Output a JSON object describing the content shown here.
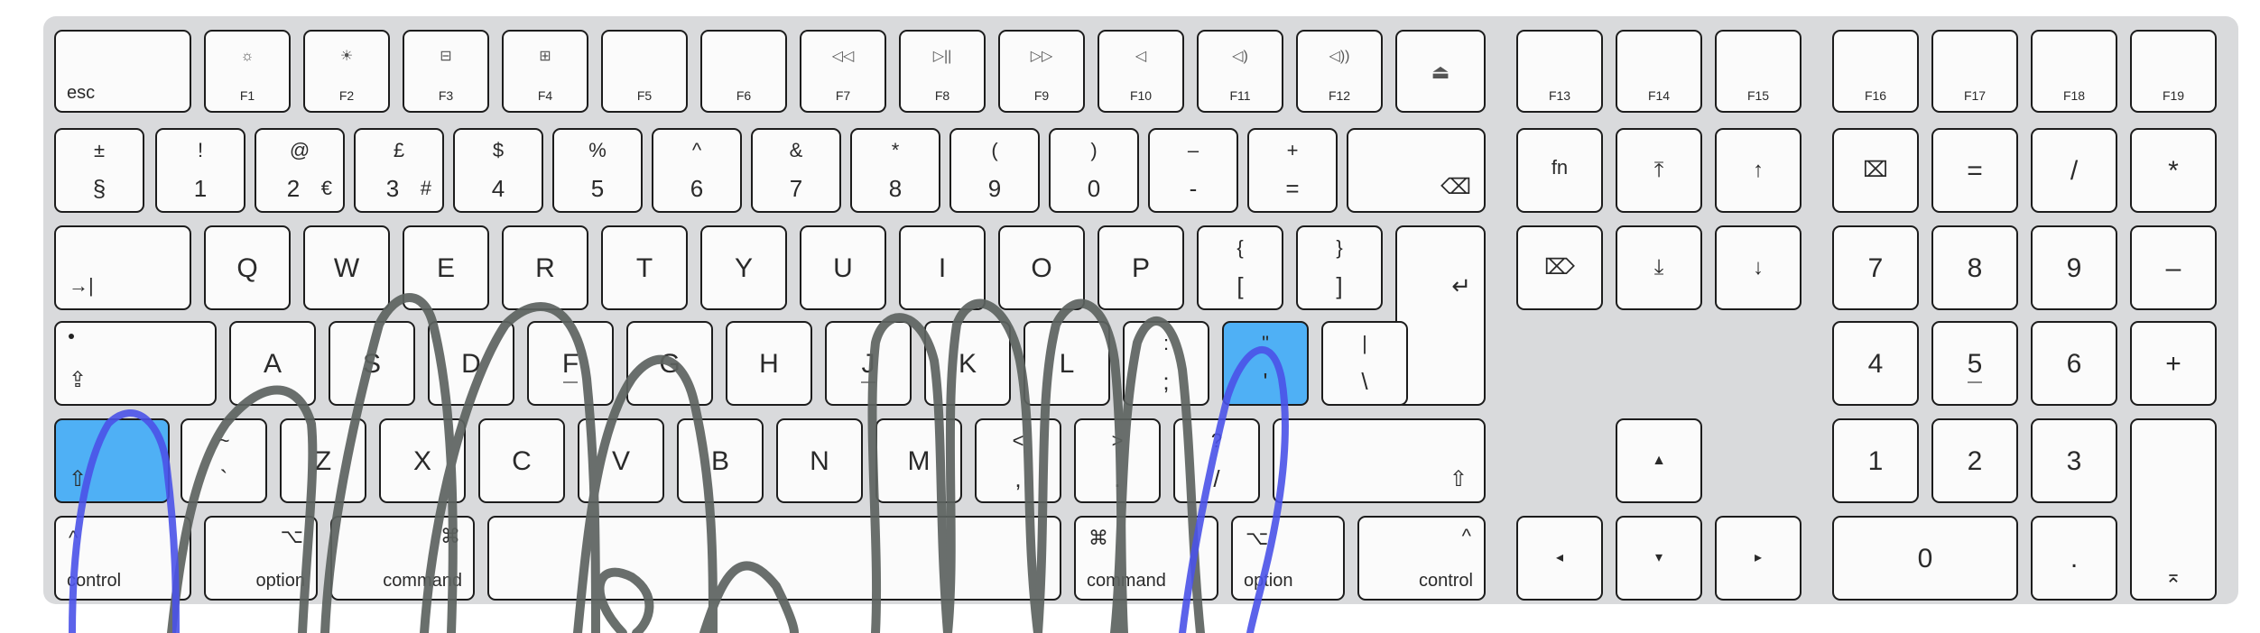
{
  "keyboard": {
    "function_row": [
      {
        "id": "esc",
        "bottom": "esc"
      },
      {
        "id": "f1",
        "icon": "☼",
        "bottom": "F1"
      },
      {
        "id": "f2",
        "icon": "☀",
        "bottom": "F2"
      },
      {
        "id": "f3",
        "icon": "⊟",
        "bottom": "F3"
      },
      {
        "id": "f4",
        "icon": "⊞",
        "bottom": "F4"
      },
      {
        "id": "f5",
        "bottom": "F5"
      },
      {
        "id": "f6",
        "bottom": "F6"
      },
      {
        "id": "f7",
        "icon": "◁◁",
        "bottom": "F7"
      },
      {
        "id": "f8",
        "icon": "▷||",
        "bottom": "F8"
      },
      {
        "id": "f9",
        "icon": "▷▷",
        "bottom": "F9"
      },
      {
        "id": "f10",
        "icon": "◁",
        "bottom": "F10"
      },
      {
        "id": "f11",
        "icon": "◁)",
        "bottom": "F11"
      },
      {
        "id": "f12",
        "icon": "◁))",
        "bottom": "F12"
      },
      {
        "id": "eject",
        "icon": "⏏"
      },
      {
        "id": "f13",
        "bottom": "F13"
      },
      {
        "id": "f14",
        "bottom": "F14"
      },
      {
        "id": "f15",
        "bottom": "F15"
      },
      {
        "id": "f16",
        "bottom": "F16"
      },
      {
        "id": "f17",
        "bottom": "F17"
      },
      {
        "id": "f18",
        "bottom": "F18"
      },
      {
        "id": "f19",
        "bottom": "F19"
      }
    ],
    "number_row": [
      {
        "id": "section",
        "top": "±",
        "bottom": "§"
      },
      {
        "id": "1",
        "top": "!",
        "bottom": "1"
      },
      {
        "id": "2",
        "top": "@",
        "bottom": "2",
        "extra": "€"
      },
      {
        "id": "3",
        "top": "£",
        "bottom": "3",
        "extra": "#"
      },
      {
        "id": "4",
        "top": "$",
        "bottom": "4"
      },
      {
        "id": "5",
        "top": "%",
        "bottom": "5"
      },
      {
        "id": "6",
        "top": "^",
        "bottom": "6"
      },
      {
        "id": "7",
        "top": "&",
        "bottom": "7"
      },
      {
        "id": "8",
        "top": "*",
        "bottom": "8"
      },
      {
        "id": "9",
        "top": "(",
        "bottom": "9"
      },
      {
        "id": "0",
        "top": ")",
        "bottom": "0"
      },
      {
        "id": "minus",
        "top": "–",
        "bottom": "-"
      },
      {
        "id": "equals",
        "top": "+",
        "bottom": "="
      },
      {
        "id": "delete",
        "icon": "⌫"
      },
      {
        "id": "fn",
        "center": "fn"
      },
      {
        "id": "home",
        "icon": "⤒"
      },
      {
        "id": "pageup",
        "icon": "↑"
      },
      {
        "id": "clear",
        "icon": "⌧"
      },
      {
        "id": "kp-equals",
        "center": "="
      },
      {
        "id": "kp-slash",
        "center": "/"
      },
      {
        "id": "kp-star",
        "center": "*"
      }
    ],
    "qwerty_row": [
      {
        "id": "tab",
        "icon": "→|"
      },
      {
        "id": "q",
        "center": "Q"
      },
      {
        "id": "w",
        "center": "W"
      },
      {
        "id": "e",
        "center": "E"
      },
      {
        "id": "r",
        "center": "R"
      },
      {
        "id": "t",
        "center": "T"
      },
      {
        "id": "y",
        "center": "Y"
      },
      {
        "id": "u",
        "center": "U"
      },
      {
        "id": "i",
        "center": "I"
      },
      {
        "id": "o",
        "center": "O"
      },
      {
        "id": "p",
        "center": "P"
      },
      {
        "id": "lbrace",
        "top": "{",
        "bottom": "["
      },
      {
        "id": "rbrace",
        "top": "}",
        "bottom": "]"
      },
      {
        "id": "return",
        "icon": "↵"
      },
      {
        "id": "fwd-delete",
        "icon": "⌦"
      },
      {
        "id": "end",
        "icon": "⤓"
      },
      {
        "id": "pagedown",
        "icon": "↓"
      },
      {
        "id": "kp7",
        "center": "7"
      },
      {
        "id": "kp8",
        "center": "8"
      },
      {
        "id": "kp9",
        "center": "9"
      },
      {
        "id": "kp-minus",
        "center": "–"
      }
    ],
    "home_row": [
      {
        "id": "caps",
        "icon": "⇪"
      },
      {
        "id": "a",
        "center": "A"
      },
      {
        "id": "s",
        "center": "S"
      },
      {
        "id": "d",
        "center": "D"
      },
      {
        "id": "f",
        "center": "F"
      },
      {
        "id": "g",
        "center": "G"
      },
      {
        "id": "h",
        "center": "H"
      },
      {
        "id": "j",
        "center": "J"
      },
      {
        "id": "k",
        "center": "K"
      },
      {
        "id": "l",
        "center": "L"
      },
      {
        "id": "semicolon",
        "top": ":",
        "bottom": ";"
      },
      {
        "id": "quote",
        "top": "\"",
        "bottom": "'"
      },
      {
        "id": "backslash",
        "top": "|",
        "bottom": "\\"
      },
      {
        "id": "kp4",
        "center": "4"
      },
      {
        "id": "kp5",
        "center": "5"
      },
      {
        "id": "kp6",
        "center": "6"
      },
      {
        "id": "kp-plus",
        "center": "+"
      }
    ],
    "shift_row": [
      {
        "id": "lshift",
        "icon": "⇧"
      },
      {
        "id": "grave",
        "top": "~",
        "bottom": "`"
      },
      {
        "id": "z",
        "center": "Z"
      },
      {
        "id": "x",
        "center": "X"
      },
      {
        "id": "c",
        "center": "C"
      },
      {
        "id": "v",
        "center": "V"
      },
      {
        "id": "b",
        "center": "B"
      },
      {
        "id": "n",
        "center": "N"
      },
      {
        "id": "m",
        "center": "M"
      },
      {
        "id": "comma",
        "top": "<",
        "bottom": ","
      },
      {
        "id": "period",
        "top": ">",
        "bottom": "."
      },
      {
        "id": "slash",
        "top": "?",
        "bottom": "/"
      },
      {
        "id": "rshift",
        "icon": "⇧"
      },
      {
        "id": "up",
        "icon": "▲"
      },
      {
        "id": "kp1",
        "center": "1"
      },
      {
        "id": "kp2",
        "center": "2"
      },
      {
        "id": "kp3",
        "center": "3"
      }
    ],
    "bottom_row": [
      {
        "id": "lcontrol",
        "icon": "^",
        "bottom": "control"
      },
      {
        "id": "loption",
        "icon": "⌥",
        "bottom": "option"
      },
      {
        "id": "lcommand",
        "icon": "⌘",
        "bottom": "command"
      },
      {
        "id": "space"
      },
      {
        "id": "rcommand",
        "icon": "⌘",
        "bottom": "command"
      },
      {
        "id": "roption",
        "icon": "⌥",
        "bottom": "option"
      },
      {
        "id": "rcontrol",
        "icon": "^",
        "bottom": "control"
      },
      {
        "id": "left",
        "icon": "◂"
      },
      {
        "id": "down",
        "icon": "▾"
      },
      {
        "id": "right",
        "icon": "▸"
      },
      {
        "id": "kp0",
        "center": "0"
      },
      {
        "id": "kp-dot",
        "center": "."
      },
      {
        "id": "kp-enter",
        "icon": "⌅"
      }
    ],
    "highlighted_keys": [
      "lshift",
      "quote"
    ],
    "colors": {
      "highlight": "#4fb0f5",
      "gray_strokes": "#5d6360",
      "blue_strokes": "#4a52e8",
      "board": "#d9dadc"
    }
  }
}
